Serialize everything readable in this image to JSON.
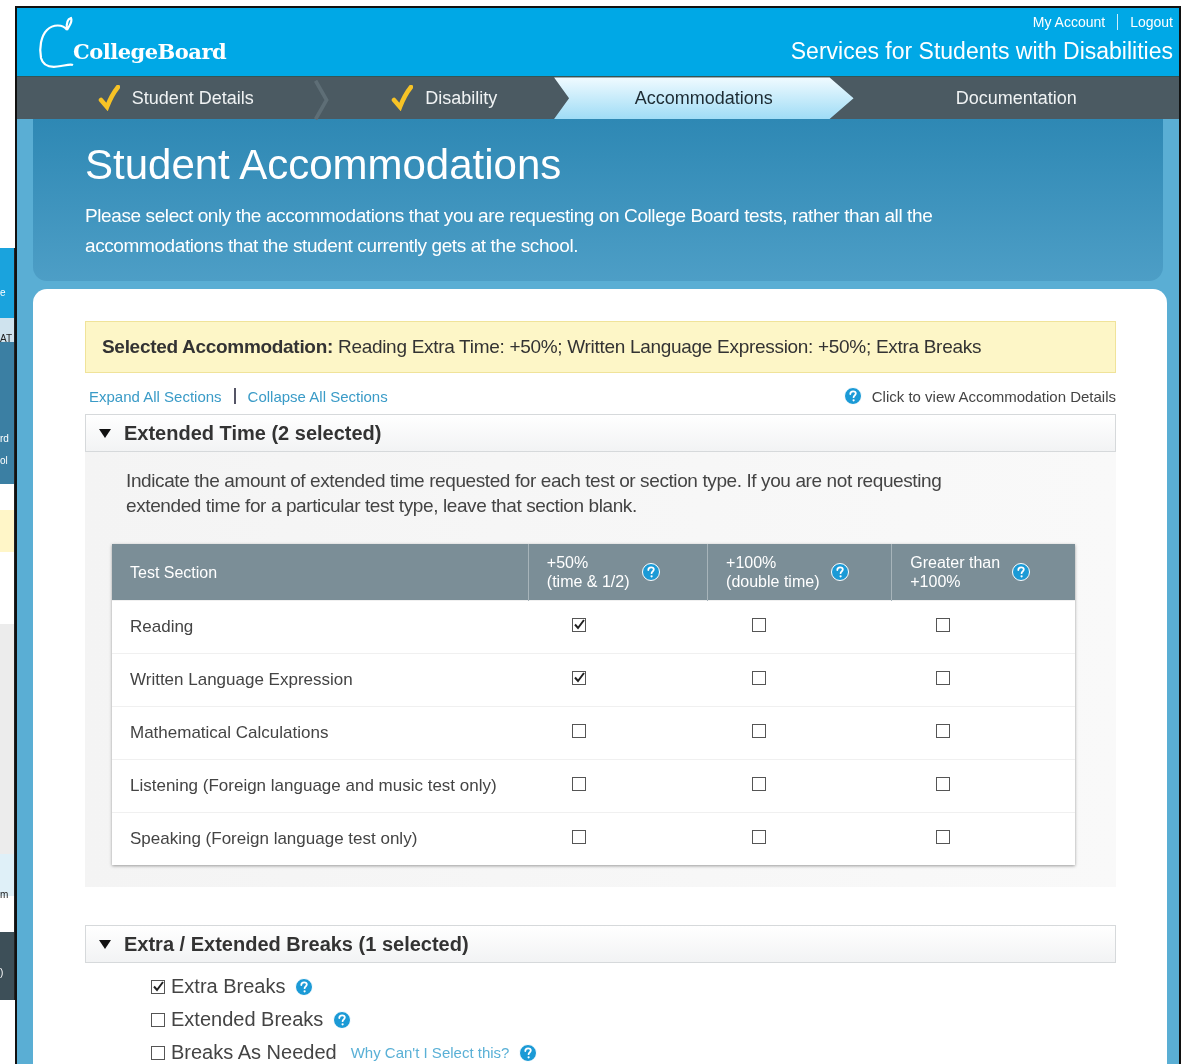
{
  "background_window": {
    "fragments": [
      "e",
      "AT",
      "rd",
      "ol",
      "m",
      ")"
    ]
  },
  "header": {
    "logo": "CollegeBoard",
    "links": [
      "My Account",
      "Logout"
    ],
    "title": "Services for Students with Disabilities"
  },
  "steps": [
    {
      "label": "Student Details",
      "completed": true,
      "selected": false
    },
    {
      "label": "Disability",
      "completed": true,
      "selected": false
    },
    {
      "label": "Accommodations",
      "completed": false,
      "selected": true
    },
    {
      "label": "Documentation",
      "completed": false,
      "selected": false
    }
  ],
  "hero": {
    "title": "Student Accommodations",
    "text": "Please select only the accommodations that you are requesting on College Board tests, rather than all the accommodations that the student currently gets at the school."
  },
  "selected_summary": {
    "label": "Selected Accommodation:",
    "value": "Reading Extra Time: +50%; Written Language Expression: +50%; Extra Breaks"
  },
  "section_links": [
    "Expand All Sections",
    "Collapse All Sections"
  ],
  "details_link": "Click to view Accommodation Details",
  "sections": [
    {
      "kind": "table",
      "title": "Extended Time (2 selected)",
      "expanded": true,
      "intro": "Indicate the amount of extended time requested for each test or section type. If you are not requesting extended time for a particular test type, leave that section blank.",
      "columns": [
        {
          "line1": "Test Section",
          "help": false
        },
        {
          "line1": "+50%",
          "line2": "(time & 1/2)",
          "help": true
        },
        {
          "line1": "+100%",
          "line2": "(double time)",
          "help": true
        },
        {
          "line1": "Greater than",
          "line2": "+100%",
          "help": true
        }
      ],
      "rows": [
        {
          "name": "Reading",
          "checks": [
            true,
            false,
            false
          ]
        },
        {
          "name": "Written Language Expression",
          "checks": [
            true,
            false,
            false
          ]
        },
        {
          "name": "Mathematical Calculations",
          "checks": [
            false,
            false,
            false
          ]
        },
        {
          "name": "Listening (Foreign language and music test only)",
          "checks": [
            false,
            false,
            false
          ]
        },
        {
          "name": "Speaking (Foreign language test only)",
          "checks": [
            false,
            false,
            false
          ]
        }
      ]
    },
    {
      "kind": "checklist",
      "title": "Extra / Extended Breaks (1 selected)",
      "expanded": true,
      "items": [
        {
          "label": "Extra Breaks",
          "checked": true,
          "help": true
        },
        {
          "label": "Extended Breaks",
          "checked": false,
          "help": true
        },
        {
          "label": "Breaks As Needed",
          "checked": false,
          "link": "Why Can't I Select this?",
          "help": true
        }
      ]
    }
  ]
}
